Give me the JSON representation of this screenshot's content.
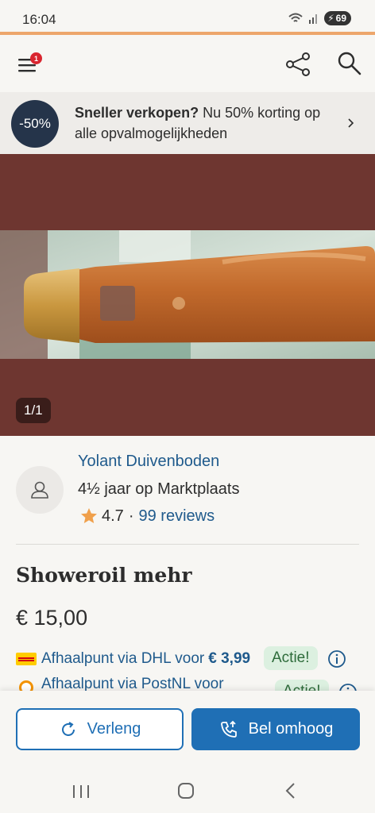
{
  "status_bar": {
    "time": "16:04",
    "battery": "69"
  },
  "header": {
    "menu_badge": "1"
  },
  "promo": {
    "badge": "-50%",
    "bold": "Sneller verkopen?",
    "text": " Nu 50% korting op alle opvalmogelijkheden"
  },
  "gallery": {
    "counter": "1/1"
  },
  "seller": {
    "name": "Yolant Duivenboden",
    "member_since": "4½ jaar op Marktplaats",
    "rating": "4.7",
    "separator": "·",
    "reviews": "99 reviews"
  },
  "listing": {
    "title": "Showeroil mehr",
    "price": "€ 15,00"
  },
  "shipping": [
    {
      "label": "Afhaalpunt via DHL voor",
      "price": "€ 3,99",
      "badge": "Actie!"
    },
    {
      "label": "Afhaalpunt via PostNL voor",
      "price": "",
      "badge": "Actie!"
    }
  ],
  "actions": {
    "extend": "Verleng",
    "bump": "Bel omhoog"
  },
  "colors": {
    "link": "#1f5a8c",
    "primary": "#1f6fb5",
    "accent_line": "#eda66b",
    "gallery_bg": "#6e3630"
  }
}
